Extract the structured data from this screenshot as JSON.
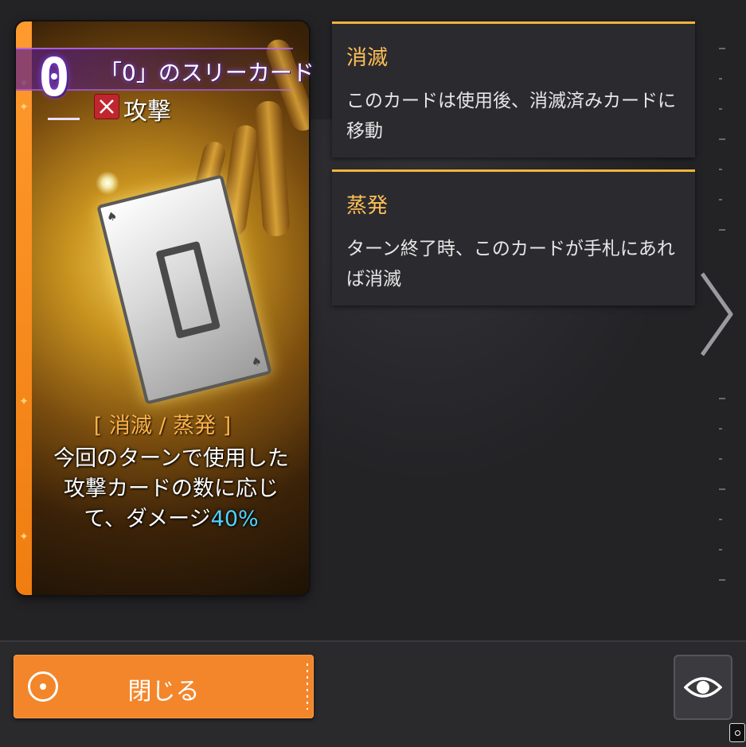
{
  "card": {
    "cost": "0",
    "name": "「0」のスリーカード",
    "type_label": "攻撃",
    "type_icon": "crossed-swords-icon",
    "tags": "[ 消滅 / 蒸発 ]",
    "description_main": "今回のターンで使用した攻撃カードの数に応じて、ダメージ",
    "description_value": "40%",
    "strip_color": "#f07d10",
    "accent_color": "#8a4bff"
  },
  "keywords": [
    {
      "title": "消滅",
      "body": "このカードは使用後、消滅済みカードに移動"
    },
    {
      "title": "蒸発",
      "body": "ターン終了時、このカードが手札にあれば消滅"
    }
  ],
  "footer": {
    "close_label": "閉じる",
    "close_icon": "radio-circle-icon",
    "view_icon": "eye-icon",
    "button_color": "#f3862a"
  },
  "nav": {
    "next_icon": "chevron-right-icon"
  }
}
